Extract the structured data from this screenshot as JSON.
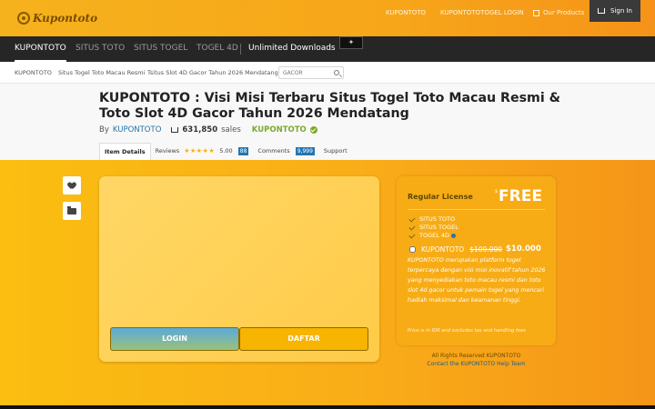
{
  "topbar": {
    "logo_text": "Kupontoto",
    "links": [
      "KUPONTOTO",
      "KUPONTOTOTOGEL LOGIN"
    ],
    "our_products": "Our Products",
    "sign_in": "Sign In"
  },
  "nav": {
    "items": [
      "KUPONTOTO",
      "SITUS TOTO",
      "SITUS TOGEL",
      "TOGEL 4D"
    ],
    "promo": "Unlimited Downloads"
  },
  "breadcrumbs": [
    "KUPONTOTO",
    "Situs Togel Toto Macau Resmi",
    "Tsitus Slot 4D Gacor Tahun 2026 Mendatang"
  ],
  "search": {
    "placeholder": "GACOR"
  },
  "product": {
    "title": "KUPONTOTO : Visi Misi Terbaru Situs Togel Toto Macau Resmi & Toto Slot 4D Gacor Tahun 2026 Mendatang",
    "by_label": "By",
    "author": "KUPONTOTO",
    "sales_count": "631,850",
    "sales_label": "sales",
    "brand": "KUPONTOTO"
  },
  "tabs": {
    "item_details": "Item Details",
    "reviews": "Reviews",
    "stars": "★★★★★",
    "rating": "5.00",
    "review_count": "88",
    "comments": "Comments",
    "comment_count": "9,999",
    "support": "Support"
  },
  "buttons": {
    "login": "LOGIN",
    "daftar": "DAFTAR"
  },
  "license": {
    "label": "Regular License",
    "currency": "$",
    "price": "FREE",
    "features": [
      "SITUS TOTO",
      "SITUS TOGEL",
      "TOGEL 4D"
    ],
    "option_label": "KUPONTOTO",
    "old_price": "$100.000",
    "new_price": "$10.000",
    "description": "KUPONTOTO merupakan platform togel terpercaya dengan visi misi inovatif tahun 2026 yang menyediakan toto macau resmi dan toto slot 4d gacor untuk pemain togel yang mencari hadiah maksimal dan keamanan tinggi.",
    "note": "Price is in IDR and excludes tax and handling fees"
  },
  "footer": {
    "rights": "All Rights Reserved KUPONTOTO",
    "contact": "Contact the KUPONTOTO Help Team"
  },
  "colors": {
    "accent": "#f7ac16",
    "nav_bg": "#262626",
    "link": "#2574a9",
    "brand_green": "#7aaa2b"
  }
}
